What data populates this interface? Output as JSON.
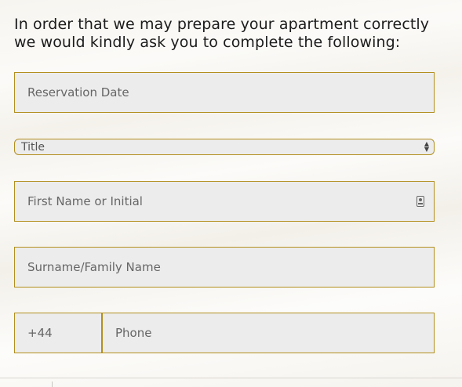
{
  "intro_text": "In order that we may prepare your apartment correctly we would kindly ask you to complete the following:",
  "fields": {
    "reservation_date": {
      "placeholder": "Reservation Date"
    },
    "title": {
      "selected": "Title"
    },
    "first_name": {
      "placeholder": "First Name or Initial",
      "icon": "contact-card-icon"
    },
    "surname": {
      "placeholder": "Surname/Family Name"
    },
    "phone": {
      "country_code": "+44",
      "placeholder": "Phone"
    }
  },
  "colors": {
    "field_border": "#b38f1f",
    "field_background": "#ececec",
    "page_background": "#f7f5f0",
    "text_primary": "#1b1b1b",
    "text_placeholder": "#666666"
  }
}
